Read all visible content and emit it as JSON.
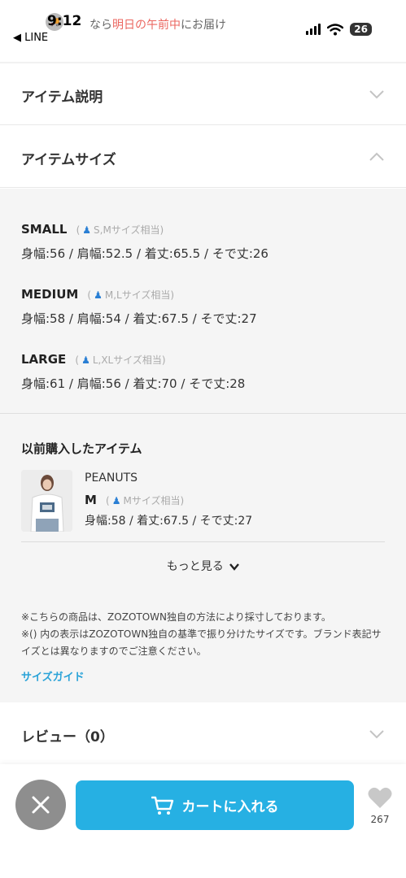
{
  "status_bar": {
    "time": "9:12",
    "back_label": "◀ LINE",
    "battery": "26",
    "banner_prefix": "なら",
    "banner_highlight": "明日の午前中",
    "banner_suffix": "にお届け"
  },
  "sections": {
    "item_description": "アイテム説明",
    "item_size": "アイテムサイズ",
    "review": "レビュー（0）"
  },
  "sizes": [
    {
      "name": "SMALL",
      "hint": "S,Mサイズ相当",
      "measurements": "身幅:56 / 肩幅:52.5 / 着丈:65.5 / そで丈:26"
    },
    {
      "name": "MEDIUM",
      "hint": "M,Lサイズ相当",
      "measurements": "身幅:58 / 肩幅:54 / 着丈:67.5 / そで丈:27"
    },
    {
      "name": "LARGE",
      "hint": "L,XLサイズ相当",
      "measurements": "身幅:61 / 肩幅:56 / 着丈:70 / そで丈:28"
    }
  ],
  "previous_purchase": {
    "title": "以前購入したアイテム",
    "brand": "PEANUTS",
    "size": "M",
    "hint": "Mサイズ相当",
    "measurements": "身幅:58 / 着丈:67.5 / そで丈:27"
  },
  "more_label": "もっと見る",
  "notes": [
    "※こちらの商品は、ZOZOTOWN独自の方法により採寸しております。",
    "※() 内の表示はZOZOTOWN独自の基準で振り分けたサイズです。ブランド表記サイズとは異なりますのでご注意ください。"
  ],
  "size_guide_label": "サイズガイド",
  "bottom_bar": {
    "cart_label": "カートに入れる",
    "favorite_count": "267"
  },
  "colors": {
    "accent": "#26b0e3",
    "link": "#2aa3d8",
    "highlight_red": "#e5332a",
    "person_icon": "#2a7fd4"
  }
}
